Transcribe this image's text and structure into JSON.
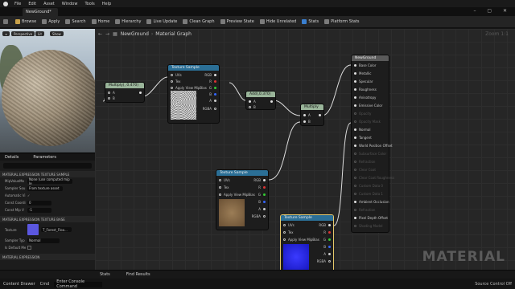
{
  "menu": [
    "File",
    "Edit",
    "Asset",
    "Window",
    "Tools",
    "Help"
  ],
  "tab": {
    "title": "NewGround*"
  },
  "toolbar": {
    "items": [
      "Browse",
      "Apply",
      "Search",
      "Home",
      "Hierarchy",
      "Live Update",
      "Clean Graph",
      "Preview State",
      "Hide Unrelated",
      "Stats",
      "Platform Stats"
    ]
  },
  "viewport": {
    "mode": "Perspective",
    "lit": "Lit",
    "show": "Show"
  },
  "details": {
    "tab1": "Details",
    "tab2": "Parameters",
    "sect1": "MATERIAL EXPRESSION TEXTURE SAMPLE",
    "rows": [
      {
        "label": "MipValueMo",
        "value": "None (use computed mip le"
      },
      {
        "label": "Sampler Sou",
        "value": "From texture asset"
      },
      {
        "label": "Automatic Vi",
        "value": "✓"
      },
      {
        "label": "Const Coordi",
        "value": "0"
      },
      {
        "label": "Const Mip V",
        "value": "-1"
      }
    ],
    "sect2": "MATERIAL EXPRESSION TEXTURE BASE",
    "texture_label": "Texture",
    "texture_value": "T_Forest_Floo...",
    "sampler_type_label": "Sampler Typ",
    "sampler_type_value": "Normal",
    "default_label": "Is Default Me",
    "sect3": "MATERIAL EXPRESSION"
  },
  "graph": {
    "breadcrumb_root": "NewGround",
    "breadcrumb_leaf": "Material Graph",
    "zoom": "Zoom 1:1",
    "watermark": "MATERIAL",
    "multiply1": {
      "title": "Multiply(, 0.470)",
      "a": "A",
      "b": "B"
    },
    "tex1": {
      "title": "Texture Sample",
      "pins_in": [
        "UVs",
        "Tex",
        "Apply View MipBias"
      ],
      "pins_out": [
        "RGB",
        "R",
        "G",
        "B",
        "A",
        "RGBA"
      ]
    },
    "add": {
      "title": "Add(,0.370)",
      "a": "A",
      "b": "B"
    },
    "multiply2": {
      "title": "Multiply",
      "a": "A",
      "b": "B"
    },
    "tex2": {
      "title": "Texture Sample",
      "pins_in": [
        "UVs",
        "Tex",
        "Apply View MipBias"
      ],
      "pins_out": [
        "RGB",
        "R",
        "G",
        "B",
        "A",
        "RGBA"
      ]
    },
    "tex3": {
      "title": "Texture Sample",
      "pins_in": [
        "UVs",
        "Tex",
        "Apply View MipBias"
      ],
      "pins_out": [
        "RGB",
        "R",
        "G",
        "B",
        "A",
        "RGBA"
      ]
    },
    "result": {
      "title": "NewGround",
      "pins": [
        "Base Color",
        "Metallic",
        "Specular",
        "Roughness",
        "Anisotropy",
        "Emissive Color",
        "Opacity",
        "Opacity Mask",
        "Normal",
        "Tangent",
        "World Position Offset",
        "Subsurface Color",
        "Refraction",
        "Clear Coat",
        "Clear Coat Roughness",
        "Custom Data 0",
        "Custom Data 1",
        "Ambient Occlusion",
        "Refraction",
        "Pixel Depth Offset",
        "Shading Model"
      ]
    }
  },
  "bottom": {
    "tab1": "Stats",
    "tab2": "Find Results",
    "content_drawer": "Content Drawer",
    "cmd": "Cmd",
    "cmd_placeholder": "Enter Console Command",
    "source_control": "Source Control Off"
  },
  "colors": {
    "tex_header": "#2b6f96",
    "mult_header": "#9ab59a",
    "result_header": "#5a5a5a",
    "accent": "#e6c86a"
  }
}
